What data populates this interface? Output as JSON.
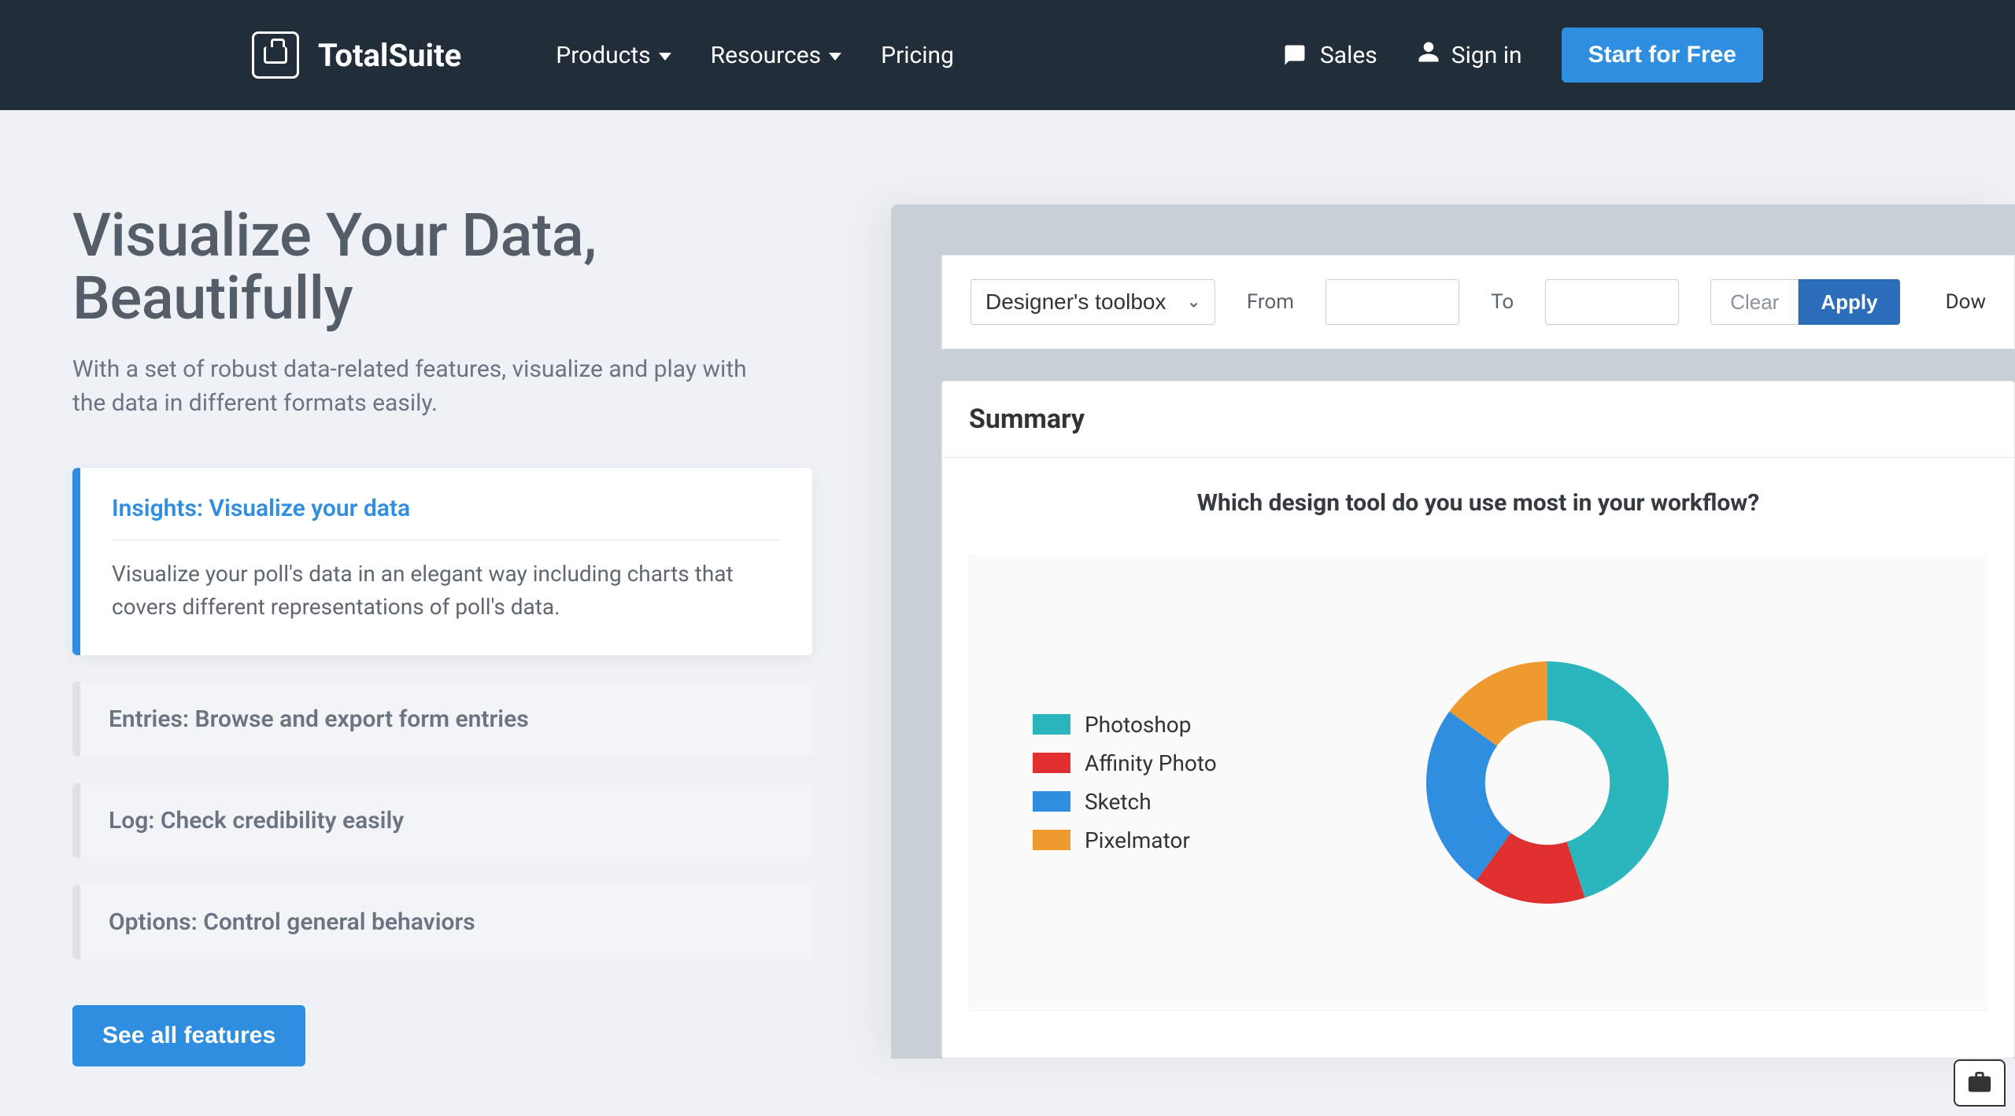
{
  "brand": {
    "name": "TotalSuite"
  },
  "nav": {
    "products": "Products",
    "resources": "Resources",
    "pricing": "Pricing"
  },
  "header_actions": {
    "sales": "Sales",
    "signin": "Sign in",
    "cta": "Start for Free"
  },
  "hero": {
    "title_line1": "Visualize Your Data,",
    "title_line2": "Beautifully",
    "subtitle": "With a set of robust data-related features, visualize and play with the data in different formats easily."
  },
  "accordion": {
    "items": [
      {
        "title": "Insights: Visualize your data",
        "body": "Visualize your poll's data in an elegant way including charts that covers different representations of poll's data."
      },
      {
        "title": "Entries: Browse and export form entries",
        "body": ""
      },
      {
        "title": "Log: Check credibility easily",
        "body": ""
      },
      {
        "title": "Options: Control general behaviors",
        "body": ""
      }
    ],
    "see_all": "See all features"
  },
  "dashboard": {
    "select_value": "Designer's toolbox",
    "from_label": "From",
    "to_label": "To",
    "clear": "Clear",
    "apply": "Apply",
    "download": "Dow",
    "summary_heading": "Summary",
    "question": "Which design tool do you use most in your workflow?"
  },
  "chart_data": {
    "type": "pie",
    "title": "Which design tool do you use most in your workflow?",
    "series": [
      {
        "name": "Photoshop",
        "value": 45,
        "color": "#2bb6bd"
      },
      {
        "name": "Affinity Photo",
        "value": 15,
        "color": "#e02f2f"
      },
      {
        "name": "Sketch",
        "value": 25,
        "color": "#2f8ee0"
      },
      {
        "name": "Pixelmator",
        "value": 15,
        "color": "#ee9a2e"
      }
    ]
  }
}
